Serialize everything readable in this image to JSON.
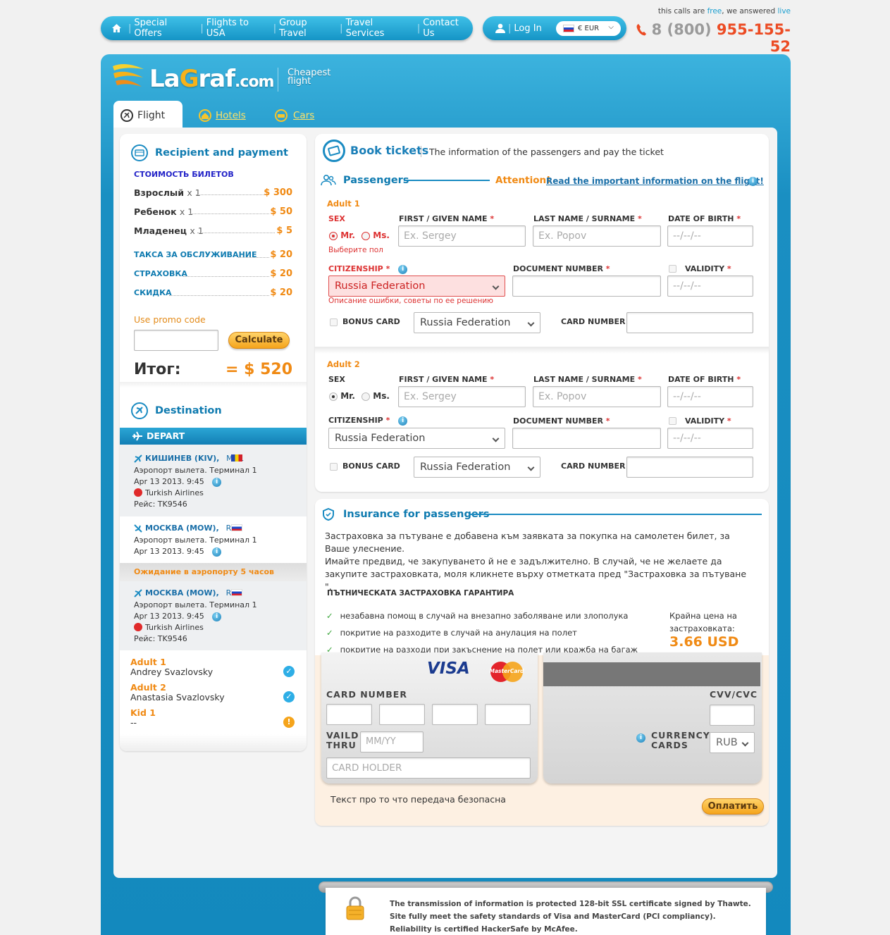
{
  "topnav": {
    "items": [
      "Special Offers",
      "Flights to USA",
      "Group Travel",
      "Travel Services",
      "Contact Us"
    ]
  },
  "login": {
    "label": "Log In",
    "currency": "€ EUR"
  },
  "calls": {
    "pre": "this calls are ",
    "free": "free",
    "mid": ", we answered ",
    "live": "live"
  },
  "phone": {
    "prefix": "8 (800) ",
    "number": "955-155-52"
  },
  "logo": {
    "la": "La",
    "g": "G",
    "raf": "raf",
    ".com": ".com",
    "tag1": "Cheapest",
    "tag2": "flight"
  },
  "tabs": {
    "flight": "Flight",
    "hotels": "Hotels",
    "cars": "Cars"
  },
  "left": {
    "title": "Recipient and payment",
    "cost_head": "СТОИМОСТЬ БИЛЕТОВ",
    "lines": [
      {
        "name": "Взрослый",
        "mult": "x 1",
        "price": "$ 300"
      },
      {
        "name": "Ребенок",
        "mult": "x 1",
        "price": "$ 50"
      },
      {
        "name": "Младенец",
        "mult": "x 1",
        "price": "$ 5"
      }
    ],
    "fees": [
      {
        "name": "ТАКСА ЗА ОБСЛУЖИВАНИЕ",
        "price": "$ 20"
      },
      {
        "name": "СТРАХОВКА",
        "price": "$ 20"
      },
      {
        "name": "СКИДКА",
        "price": "$ 20"
      }
    ],
    "promo": "Use promo code",
    "calc": "Calculate",
    "total_label": "Итог:",
    "total": "= $ 520",
    "dest_title": "Destination",
    "depart": "DEPART",
    "legs": [
      {
        "city": "КИШИНЕВ (KIV),",
        "code": "MDL",
        "airport": "Аэропорт вылета. Терминал 1",
        "date": "Apr 13 2013. 9:45",
        "airline": "Turkish Airlines",
        "flight": "Рейс: TK9546"
      },
      {
        "city": "МОСКВА (MOW),",
        "code": "RUS",
        "airport": "Аэропорт вылета. Терминал 1",
        "date": "Apr 13 2013. 9:45"
      },
      {
        "city": "МОСКВА (MOW),",
        "code": "RUS",
        "airport": "Аэропорт вылета. Терминал 1",
        "date": "Apr 13 2013. 9:45",
        "airline": "Turkish Airlines",
        "flight": "Рейс: TK9546"
      }
    ],
    "wait": "Ожидание в аэропорту 5 часов",
    "pax": [
      {
        "role": "Adult 1",
        "name": "Andrey Svazlovsky"
      },
      {
        "role": "Adult 2",
        "name": "Anastasia Svazlovsky"
      },
      {
        "role": "Kid 1",
        "name": "--"
      }
    ]
  },
  "book": {
    "title": "Book tickets",
    "subtitle": "The information of the passengers and pay the ticket",
    "passengers": "Passengers",
    "attention": "Attention!",
    "attention_link": "Read the important information on the flight!",
    "adult1": "Adult 1",
    "adult2": "Adult 2",
    "sex": "SEX",
    "mr": "Mr.",
    "ms": "Ms.",
    "sex_err": "Выберите пол",
    "first": "FIRST / GIVEN NAME",
    "last": "LAST NAME / SURNAME",
    "dob": "DATE OF BIRTH",
    "first_ph": "Ex. Sergey",
    "last_ph": "Ex. Popov",
    "date_ph": "--/--/--",
    "citizenship": "CITIZENSHIP",
    "citizenship_val": "Russia Federation",
    "cit_err": "Описание ошибки, советы по ее решению",
    "doc": "DOCUMENT NUMBER",
    "validity": "VALIDITY",
    "bonus": "BONUS CARD",
    "bonus_val": "Russia Federation",
    "cardnum": "CARD NUMBER",
    "req": "*"
  },
  "insurance": {
    "title": "Insurance for passengers",
    "p1": "Застраховка за пътуване е добавена към заявката за покупка на самолетен билет, за Ваше улеснение.",
    "p2": "Имайте предвид, че закупуването й не е задължително. В случай, че не желаете да закупите застраховката, моля кликнете върху отметката пред \"Застраховка за пътуване \".",
    "head": "ПЪТНИЧЕСКАТА ЗАСТРАХОВКА ГАРАНТИРА",
    "items": [
      "незабавна помощ в случай на внезапно заболяване или злополука",
      "покритие на разходите в случай на анулация на полет",
      "покритие на разходи при закъснение на полет или кражба на багаж"
    ],
    "price_label1": "Крайна цена на",
    "price_label2": "застраховката:",
    "price": "3.66 USD"
  },
  "payment": {
    "visa": "VISA",
    "mc": "MasterCard",
    "card_number": "CARD NUMBER",
    "valid1": "VAILD",
    "valid2": "THRU",
    "mmyy": "MM/YY",
    "holder": "CARD HOLDER",
    "cvv": "CVV/CVC",
    "currency1": "CURRENCY",
    "currency2": "CARDS",
    "currency_val": "RUB",
    "secure": "Текст про то что передача безопасна",
    "pay": "Оплатить"
  },
  "ssl": {
    "text": "The transmission of information is protected 128-bit SSL certificate signed by Thawte. Site fully meet the safety standards of Visa and MasterCard (PCI compliancy). Reliability is certified HackerSafe by McAfee."
  }
}
